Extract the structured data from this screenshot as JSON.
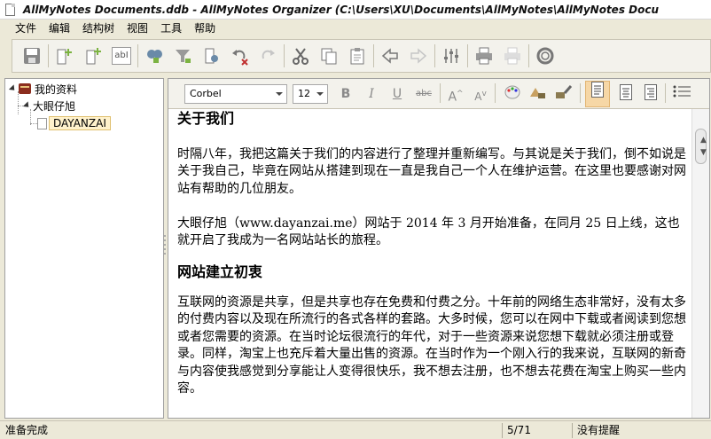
{
  "window": {
    "title": "AllMyNotes Documents.ddb - AllMyNotes Organizer (C:\\Users\\XU\\Documents\\AllMyNotes\\AllMyNotes Docu"
  },
  "menu": [
    "文件",
    "编辑",
    "结构树",
    "视图",
    "工具",
    "帮助"
  ],
  "toolbar": {
    "icons": [
      "save-icon",
      "add-sibling-note-icon",
      "add-child-note-icon",
      "rename-icon",
      "find-icon",
      "find-replace-icon",
      "find-in-note-icon",
      "undo-icon",
      "redo-icon",
      "cut-icon",
      "copy-icon",
      "paste-icon",
      "back-icon",
      "forward-icon",
      "settings-icon",
      "print-icon",
      "print-preview-icon",
      "help-icon"
    ]
  },
  "tree": {
    "items": [
      {
        "label": "我的资料",
        "icon": "book-icon",
        "level": 0
      },
      {
        "label": "大眼仔旭",
        "icon": "note-icon",
        "level": 1
      },
      {
        "label": "DAYANZAI",
        "icon": "page-icon",
        "level": 2,
        "selected": true
      }
    ]
  },
  "format": {
    "font": "Corbel",
    "size": "12",
    "bold": "B",
    "italic": "I",
    "underline": "U",
    "strike": "abc",
    "grow": "A",
    "shrink": "A"
  },
  "document": {
    "heading1": "关于我们",
    "p1": "时隔八年，我把这篇关于我们的内容进行了整理并重新编写。与其说是关于我们，倒不如说是关于我自己，毕竟在网站从搭建到现在一直是我自己一个人在维护运营。在这里也要感谢对网站有帮助的几位朋友。",
    "p2": "大眼仔旭（www.dayanzai.me）网站于 2014 年 3 月开始准备，在同月 25 日上线，这也就开启了我成为一名网站站长的旅程。",
    "heading2": "网站建立初衷",
    "p3": "互联网的资源是共享，但是共享也存在免费和付费之分。十年前的网络生态非常好，没有太多的付费内容以及现在所流行的各式各样的套路。大多时候，您可以在网中下载或者阅读到您想或者您需要的资源。在当时论坛很流行的年代，对于一些资源来说您想下载就必须注册或登录。同样，淘宝上也充斥着大量出售的资源。在当时作为一个刚入行的我来说，互联网的新奇与内容使我感觉到分享能让人变得很快乐，我不想去注册，也不想去花费在淘宝上购买一些内容。"
  },
  "status": {
    "left": "准备完成",
    "position": "5/71",
    "reminder": "没有提醒"
  }
}
